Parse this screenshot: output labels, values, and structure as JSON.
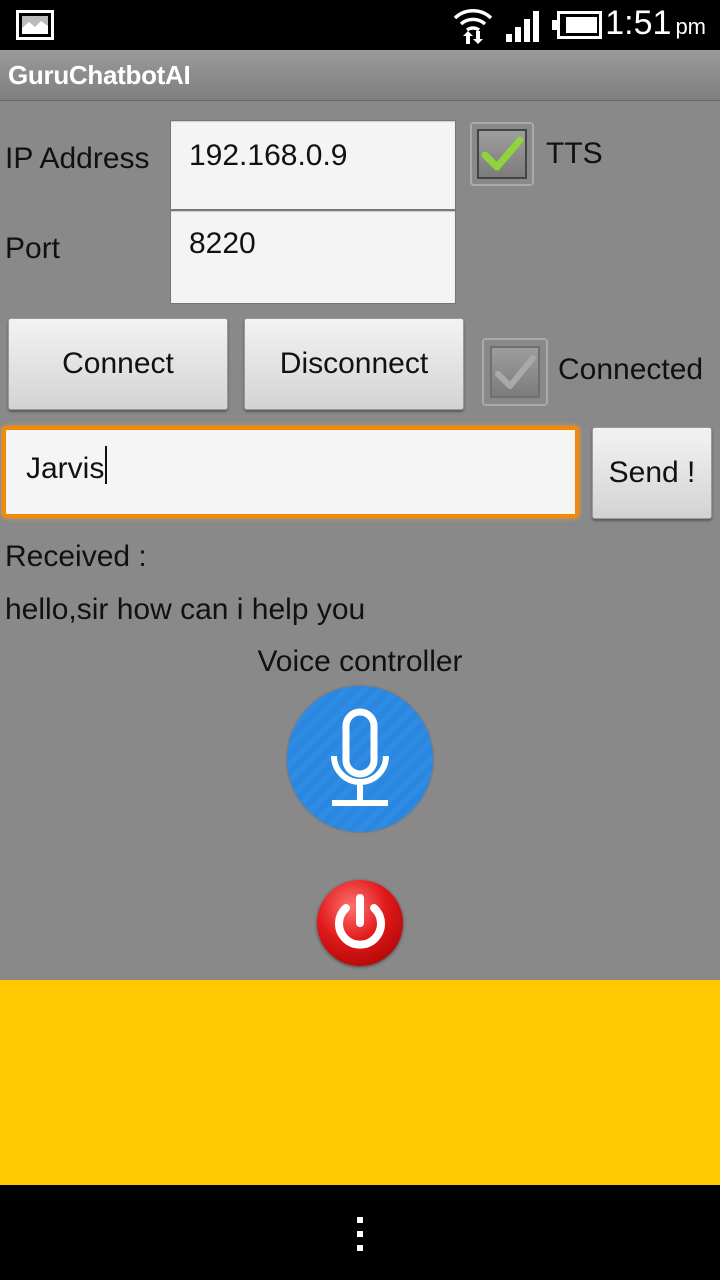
{
  "status_bar": {
    "time": "1:51",
    "ampm": "pm"
  },
  "app": {
    "title": "GuruChatbotAI"
  },
  "form": {
    "ip_label": "IP Address",
    "ip_value": "192.168.0.9",
    "port_label": "Port",
    "port_value": "8220",
    "tts_label": "TTS",
    "tts_checked": true
  },
  "buttons": {
    "connect": "Connect",
    "disconnect": "Disconnect",
    "send": "Send !"
  },
  "connection": {
    "label": "Connected",
    "checked": true
  },
  "message": {
    "value": "Jarvis"
  },
  "received": {
    "label": "Received :",
    "text": "hello,sir how can i help you"
  },
  "voice": {
    "label": "Voice controller"
  },
  "icons": {
    "status": [
      "picture-icon",
      "wifi-icon",
      "signal-icon",
      "battery-icon"
    ],
    "mic": "microphone-icon",
    "power": "power-icon",
    "menu": "overflow-menu-icon"
  },
  "colors": {
    "accent_orange": "#f08a0a",
    "mic_blue": "#2f8ce5",
    "power_red": "#e01818",
    "banner_yellow": "#ffc800"
  }
}
